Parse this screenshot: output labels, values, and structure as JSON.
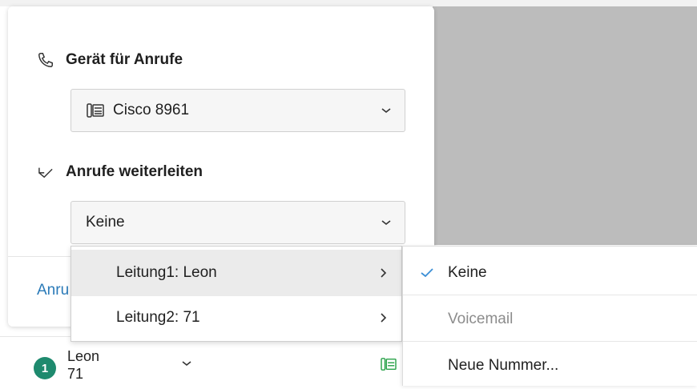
{
  "panel": {
    "device_section": {
      "title": "Gerät für Anrufe",
      "icon": "phone-icon",
      "select_value": "Cisco 8961",
      "select_icon": "desk-phone-icon"
    },
    "forward_section": {
      "title": "Anrufe weiterleiten",
      "icon": "call-forward-icon",
      "select_value": "Keine"
    },
    "link_partial": "Anru"
  },
  "forward_menu": {
    "items": [
      {
        "label": "Leitung1: Leon",
        "highlighted": true
      },
      {
        "label": "Leitung2: 71",
        "highlighted": false
      }
    ]
  },
  "forward_submenu": {
    "items": [
      {
        "label": "Keine",
        "checked": true,
        "enabled": true
      },
      {
        "label": "Voicemail",
        "checked": false,
        "enabled": false
      },
      {
        "label": "Neue Nummer...",
        "checked": false,
        "enabled": true
      }
    ]
  },
  "status_bar": {
    "badge_count": "1",
    "user_name": "Leon",
    "user_number": "71"
  },
  "colors": {
    "accent_blue": "#2a7ab8",
    "check_blue": "#3b8fd6",
    "badge_green": "#1e8a6e",
    "line_icon_green": "#2aa24a",
    "backdrop_gray": "#bcbcbc"
  }
}
